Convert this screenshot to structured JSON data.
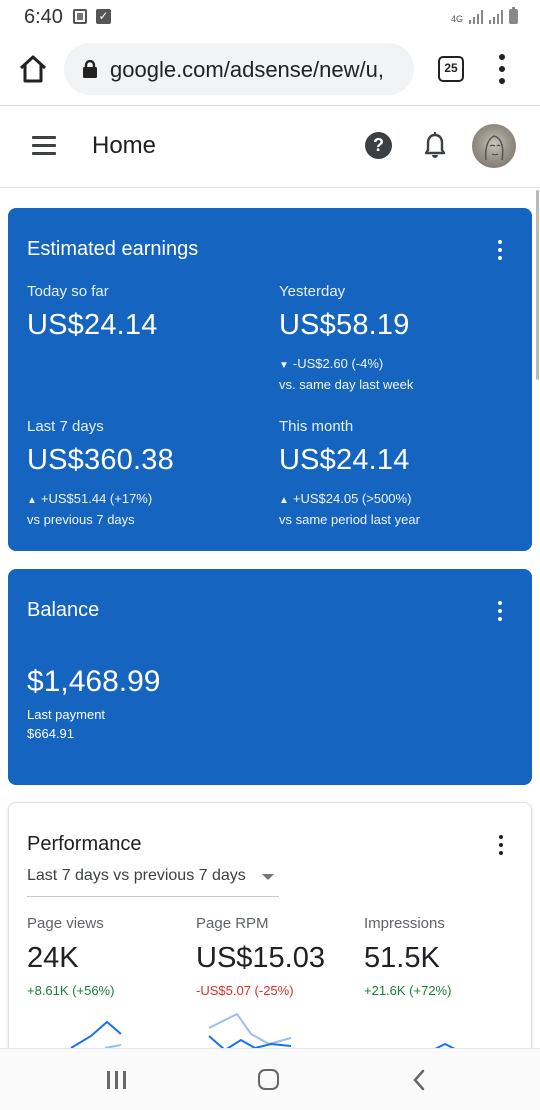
{
  "status_bar": {
    "time": "6:40",
    "network": "4G"
  },
  "browser": {
    "url": "google.com/adsense/new/u,",
    "tab_count": "25"
  },
  "app_bar": {
    "title": "Home"
  },
  "earnings": {
    "title": "Estimated earnings",
    "metrics": [
      {
        "label": "Today so far",
        "value": "US$24.14",
        "change": "",
        "compare": ""
      },
      {
        "label": "Yesterday",
        "value": "US$58.19",
        "change": "-US$2.60 (-4%)",
        "compare": "vs. same day last week",
        "direction": "down"
      },
      {
        "label": "Last 7 days",
        "value": "US$360.38",
        "change": "+US$51.44 (+17%)",
        "compare": "vs previous 7 days",
        "direction": "up"
      },
      {
        "label": "This month",
        "value": "US$24.14",
        "change": "+US$24.05 (>500%)",
        "compare": "vs same period last year",
        "direction": "up"
      }
    ]
  },
  "balance": {
    "title": "Balance",
    "value": "$1,468.99",
    "last_payment_label": "Last payment",
    "last_payment_amount": "$664.91"
  },
  "performance": {
    "title": "Performance",
    "range": "Last 7 days vs previous 7 days",
    "stats": [
      {
        "label": "Page views",
        "value": "24K",
        "change": "+8.61K (+56%)",
        "trend": "positive"
      },
      {
        "label": "Page RPM",
        "value": "US$15.03",
        "change": "-US$5.07 (-25%)",
        "trend": "negative"
      },
      {
        "label": "Impressions",
        "value": "51.5K",
        "change": "+21.6K (+72%)",
        "trend": "positive"
      }
    ]
  },
  "colors": {
    "card_blue": "#1565c0",
    "positive": "#188038",
    "negative": "#d93025",
    "spark_line": "#1a73e8"
  },
  "icons": [
    "home-icon",
    "lock-icon",
    "tabs-icon",
    "overflow-menu-icon",
    "hamburger-icon",
    "help-icon",
    "bell-icon",
    "avatar",
    "recent-apps-icon",
    "home-nav-icon",
    "back-icon"
  ]
}
